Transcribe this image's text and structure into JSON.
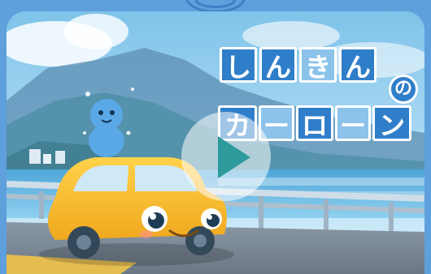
{
  "video": {
    "title_line1": [
      "し",
      "ん",
      "き",
      "ん"
    ],
    "particle": "の",
    "title_line2": [
      "カ",
      "ー",
      "ロ",
      "ー",
      "ン"
    ],
    "play_icon": "play-icon"
  },
  "colors": {
    "frame": "#5ea0dc",
    "title_blue": "#2f7ec9",
    "title_light": "#8cc3ea",
    "car": "#f4b92e",
    "play": "#2d9b9b"
  }
}
